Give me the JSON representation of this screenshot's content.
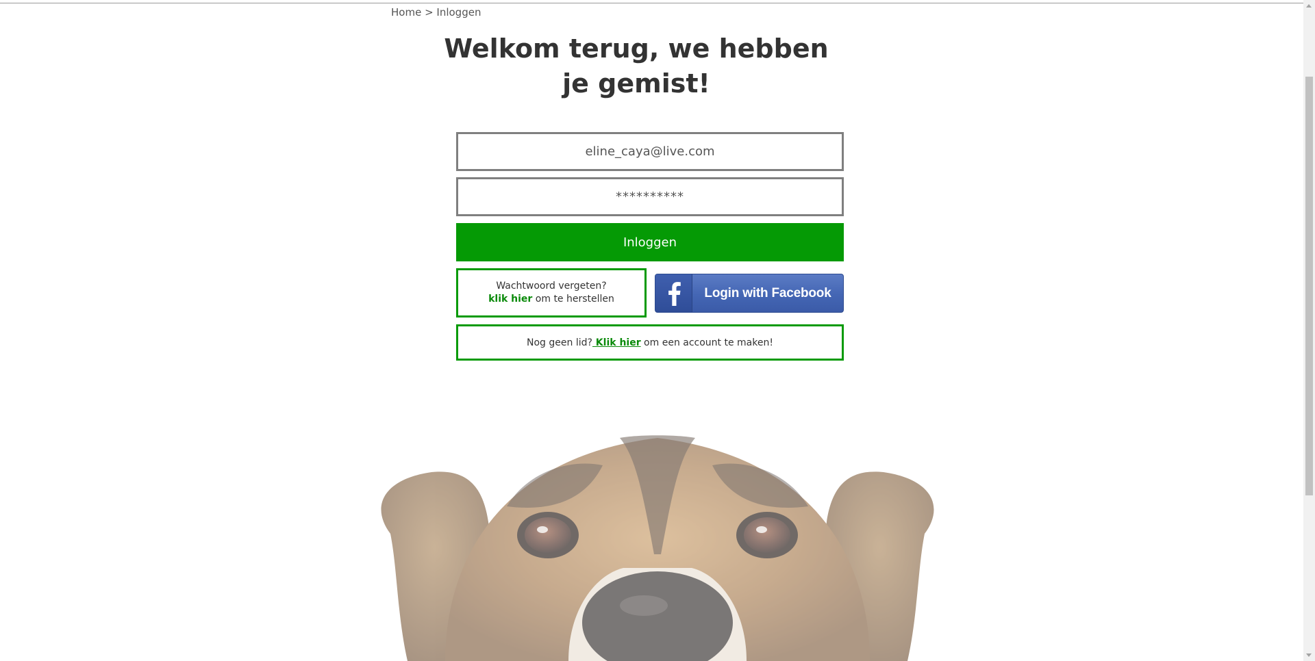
{
  "breadcrumb": {
    "home": "Home",
    "separator": " > ",
    "current": "Inloggen"
  },
  "title": {
    "line1": "Welkom terug, we hebben",
    "line2": "je gemist!"
  },
  "form": {
    "email_value": "eline_caya@live.com",
    "password_value": "**********",
    "login_label": "Inloggen"
  },
  "forgot": {
    "line1": "Wachtwoord vergeten?",
    "link": "klik hier",
    "rest": " om te herstellen"
  },
  "facebook": {
    "label": "Login with Facebook"
  },
  "signup": {
    "prefix": "Nog geen lid?",
    "link": " Klik hier",
    "suffix": " om een account te maken!"
  },
  "colors": {
    "accent_green": "#059a05",
    "facebook_blue": "#4466b4",
    "input_border": "#7f7f7f"
  }
}
